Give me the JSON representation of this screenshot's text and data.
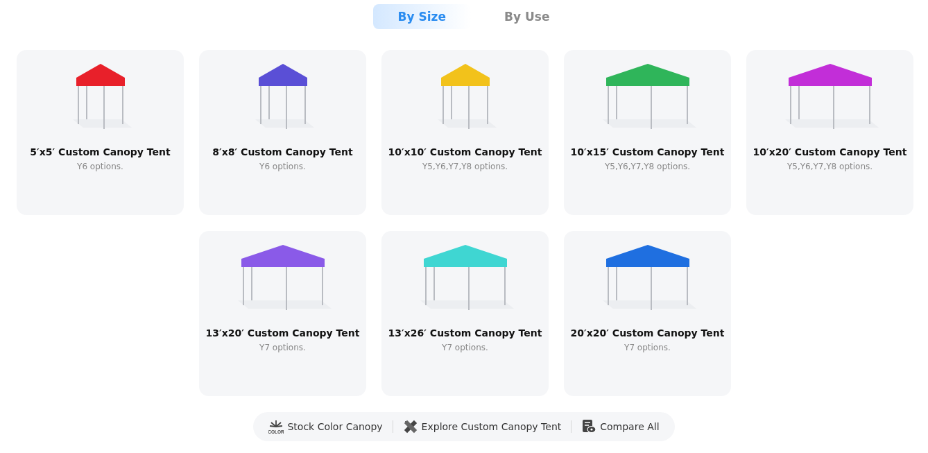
{
  "tabs": [
    {
      "label": "By Size",
      "selected": true
    },
    {
      "label": "By Use",
      "selected": false
    }
  ],
  "products": [
    {
      "title": "5′x5′ Custom Canopy Tent",
      "options": "Y6 options.",
      "color": "#e8202a",
      "kind": "square"
    },
    {
      "title": "8′x8′ Custom Canopy Tent",
      "options": "Y6 options.",
      "color": "#5a4fd6",
      "kind": "square"
    },
    {
      "title": "10′x10′ Custom Canopy Tent",
      "options": "Y5,Y6,Y7,Y8 options.",
      "color": "#f2c21b",
      "kind": "square"
    },
    {
      "title": "10′x15′ Custom Canopy Tent",
      "options": "Y5,Y6,Y7,Y8 options.",
      "color": "#2fb55a",
      "kind": "wide"
    },
    {
      "title": "10′x20′ Custom Canopy Tent",
      "options": "Y5,Y6,Y7,Y8 options.",
      "color": "#c22ed8",
      "kind": "wide"
    },
    {
      "title": "13′x20′ Custom Canopy Tent",
      "options": "Y7 options.",
      "color": "#8a5ae8",
      "kind": "wide"
    },
    {
      "title": "13′x26′ Custom Canopy Tent",
      "options": "Y7 options.",
      "color": "#3fd6d2",
      "kind": "wide"
    },
    {
      "title": "20′x20′ Custom Canopy Tent",
      "options": "Y7 options.",
      "color": "#1f6fe0",
      "kind": "wide"
    }
  ],
  "links": [
    {
      "kind": "stock",
      "label": "Stock Color Canopy",
      "icon_text": "COLOR"
    },
    {
      "kind": "explore",
      "label": "Explore Custom Canopy Tent"
    },
    {
      "kind": "compare",
      "label": "Compare All"
    }
  ]
}
